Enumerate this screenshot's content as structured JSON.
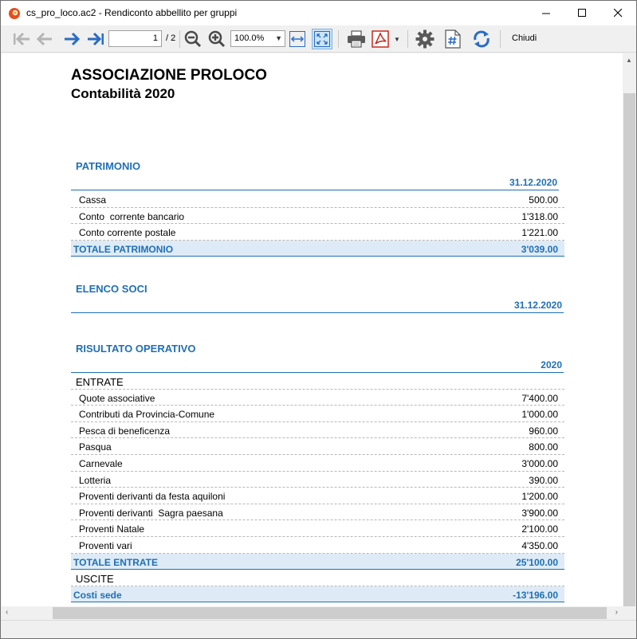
{
  "window": {
    "title": "cs_pro_loco.ac2 - Rendiconto abbellito per gruppi",
    "minimize": "—",
    "maximize": "☐",
    "close": "✕"
  },
  "toolbar": {
    "page_current": "1",
    "page_total": "/ 2",
    "zoom": "100.0%",
    "close_label": "Chiudi"
  },
  "document": {
    "title": "ASSOCIAZIONE PROLOCO",
    "subtitle": "Contabilità 2020",
    "patrimonio": {
      "title": "PATRIMONIO",
      "column": "31.12.2020",
      "rows": [
        {
          "label": "Cassa",
          "value": "500.00"
        },
        {
          "label": "Conto  corrente bancario",
          "value": "1'318.00"
        },
        {
          "label": "Conto corrente postale",
          "value": "1'221.00"
        }
      ],
      "total": {
        "label": "TOTALE PATRIMONIO",
        "value": "3'039.00"
      }
    },
    "soci": {
      "title": "ELENCO SOCI",
      "column": "31.12.2020"
    },
    "risultato": {
      "title": "RISULTATO OPERATIVO",
      "column": "2020",
      "entrate_label": "ENTRATE",
      "entrate": [
        {
          "label": "Quote associative",
          "value": "7'400.00"
        },
        {
          "label": "Contributi da Provincia-Comune",
          "value": "1'000.00"
        },
        {
          "label": "Pesca di beneficenza",
          "value": "960.00"
        },
        {
          "label": "Pasqua",
          "value": "800.00"
        },
        {
          "label": "Carnevale",
          "value": "3'000.00"
        },
        {
          "label": "Lotteria",
          "value": "390.00"
        },
        {
          "label": "Proventi derivanti da festa aquiloni",
          "value": "1'200.00"
        },
        {
          "label": "Proventi derivanti  Sagra paesana",
          "value": "3'900.00"
        },
        {
          "label": "Proventi Natale",
          "value": "2'100.00"
        },
        {
          "label": "Proventi vari",
          "value": "4'350.00"
        }
      ],
      "total_entrate": {
        "label": "TOTALE ENTRATE",
        "value": "25'100.00"
      },
      "uscite_label": "USCITE",
      "costi_sede": {
        "label": "Costi sede",
        "value": "-13'196.00"
      }
    }
  }
}
